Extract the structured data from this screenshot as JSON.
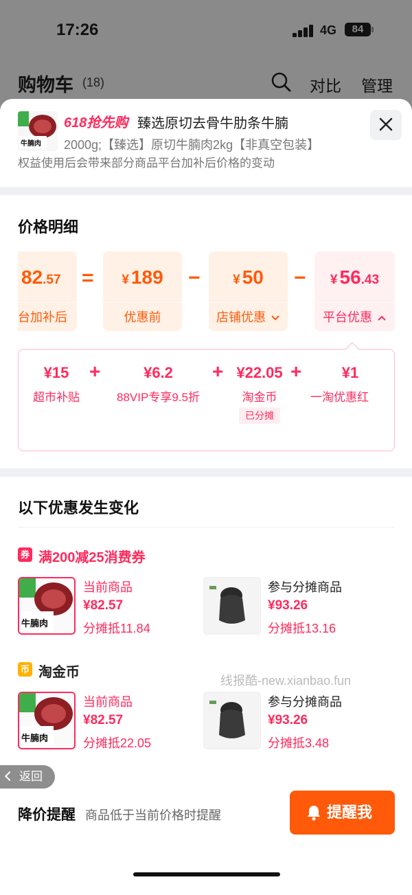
{
  "status_bar": {
    "time": "17:26",
    "network": "4G",
    "battery": "84"
  },
  "header": {
    "title": "购物车",
    "count": "(18)",
    "compare_label": "对比",
    "manage_label": "管理"
  },
  "product": {
    "promo_tag": "618抢先购",
    "name": "臻选原切去骨牛肋条牛腩",
    "sku": "2000g;【臻选】原切牛腩肉2kg【非真空包装】",
    "note": "权益使用后会带来部分商品平台加补后价格的变动",
    "thumb_text": "牛腩肉"
  },
  "price_detail": {
    "title": "价格明细",
    "final": {
      "int": "82",
      "dec": ".57",
      "label": "台加补后"
    },
    "before": {
      "cur": "¥",
      "int": "189",
      "label": "优惠前"
    },
    "shop": {
      "cur": "¥",
      "int": "50",
      "label": "店铺优惠"
    },
    "platform": {
      "cur": "¥",
      "int": "56",
      "dec": ".43",
      "label": "平台优惠"
    },
    "op_eq": "=",
    "op_minus": "−",
    "sub_items": [
      {
        "amount": "¥15",
        "label": "超市补贴"
      },
      {
        "amount": "¥6.2",
        "label": "88VIP专享9.5折"
      },
      {
        "amount": "¥22.05",
        "label": "淘金币",
        "badge": "已分摊"
      },
      {
        "amount": "¥1",
        "label": "一淘优惠红"
      }
    ],
    "plus": "+"
  },
  "changes": {
    "title": "以下优惠发生变化",
    "groups": [
      {
        "name": "满200减25消费券",
        "icon_text": "券",
        "color": "#ff2a5c",
        "current": {
          "label": "当前商品",
          "price": "¥82.57",
          "share": "分摊抵11.84"
        },
        "other": {
          "label": "参与分摊商品",
          "price": "¥93.26",
          "share": "分摊抵13.16"
        }
      },
      {
        "name": "淘金币",
        "icon_text": "币",
        "color": "#ffb300",
        "current": {
          "label": "当前商品",
          "price": "¥82.57",
          "share": "分摊抵22.05"
        },
        "other": {
          "label": "参与分摊商品",
          "price": "¥93.26",
          "share": "分摊抵3.48"
        }
      }
    ]
  },
  "watermark": "线报酷-new.xianbao.fun",
  "back_label": "返回",
  "remind": {
    "title": "降价提醒",
    "desc": "商品低于当前价格时提醒",
    "button": "提醒我"
  }
}
